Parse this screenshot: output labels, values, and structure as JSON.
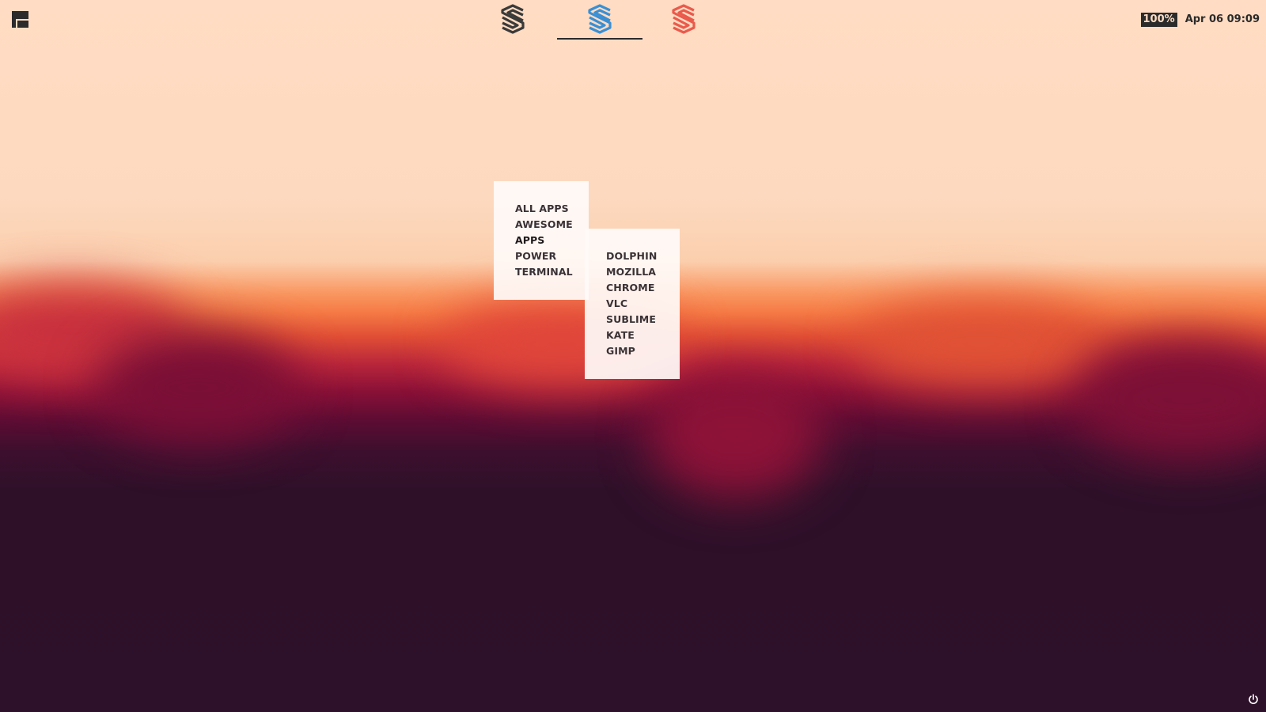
{
  "topbar": {
    "menu_icon": "launcher-menu-icon",
    "workspaces": [
      {
        "icon": "stack-icon",
        "color": "#3a3a3a",
        "active": false
      },
      {
        "icon": "stack-icon",
        "color": "#3a8fd4",
        "active": true
      },
      {
        "icon": "stack-icon",
        "color": "#ea5a4c",
        "active": false
      }
    ],
    "battery": "100%",
    "clock": "Apr 06 09:09"
  },
  "menu": {
    "main_items": [
      "ALL APPS",
      "AWESOME",
      "APPS",
      "POWER",
      "TERMINAL"
    ],
    "sub_items": [
      "DOLPHIN",
      "MOZILLA",
      "CHROME",
      "VLC",
      "SUBLIME",
      "KATE",
      "GIMP"
    ]
  },
  "footer": {
    "power_icon": "power-icon"
  },
  "colors": {
    "bar_dark": "#2b2b2b",
    "wallpaper_top": "#ffdcc3",
    "wallpaper_bottom": "#2d1029"
  }
}
